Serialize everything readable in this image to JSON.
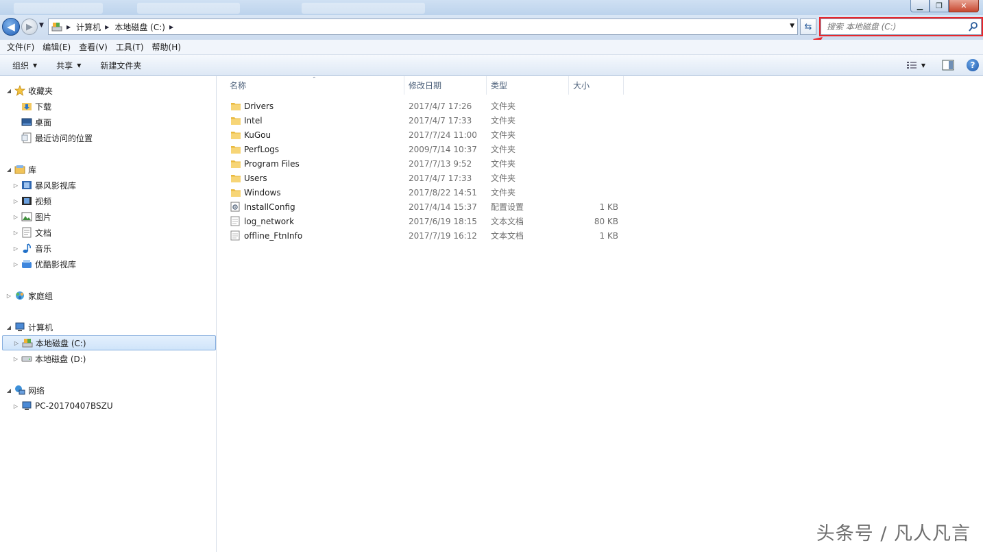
{
  "nav": {
    "breadcrumb": [
      "计算机",
      "本地磁盘 (C:)"
    ]
  },
  "search": {
    "placeholder": "搜索 本地磁盘 (C:)"
  },
  "menu": [
    "文件(F)",
    "编辑(E)",
    "查看(V)",
    "工具(T)",
    "帮助(H)"
  ],
  "toolbar": {
    "organize": "组织",
    "share": "共享",
    "new_folder": "新建文件夹"
  },
  "tree": {
    "favorites": "收藏夹",
    "fav_items": [
      "下载",
      "桌面",
      "最近访问的位置"
    ],
    "libraries": "库",
    "lib_items": [
      "暴风影视库",
      "视频",
      "图片",
      "文档",
      "音乐",
      "优酷影视库"
    ],
    "homegroup": "家庭组",
    "computer": "计算机",
    "drives": [
      "本地磁盘 (C:)",
      "本地磁盘 (D:)"
    ],
    "network": "网络",
    "net_items": [
      "PC-20170407BSZU"
    ]
  },
  "columns": {
    "name": "名称",
    "date": "修改日期",
    "type": "类型",
    "size": "大小"
  },
  "files": [
    {
      "name": "Drivers",
      "date": "2017/4/7 17:26",
      "type": "文件夹",
      "size": "",
      "icon": "folder-icon"
    },
    {
      "name": "Intel",
      "date": "2017/4/7 17:33",
      "type": "文件夹",
      "size": "",
      "icon": "folder-icon"
    },
    {
      "name": "KuGou",
      "date": "2017/7/24 11:00",
      "type": "文件夹",
      "size": "",
      "icon": "folder-icon"
    },
    {
      "name": "PerfLogs",
      "date": "2009/7/14 10:37",
      "type": "文件夹",
      "size": "",
      "icon": "folder-icon"
    },
    {
      "name": "Program Files",
      "date": "2017/7/13 9:52",
      "type": "文件夹",
      "size": "",
      "icon": "folder-icon"
    },
    {
      "name": "Users",
      "date": "2017/4/7 17:33",
      "type": "文件夹",
      "size": "",
      "icon": "folder-icon"
    },
    {
      "name": "Windows",
      "date": "2017/8/22 14:51",
      "type": "文件夹",
      "size": "",
      "icon": "folder-icon"
    },
    {
      "name": "InstallConfig",
      "date": "2017/4/14 15:37",
      "type": "配置设置",
      "size": "1 KB",
      "icon": "config-file-icon"
    },
    {
      "name": "log_network",
      "date": "2017/6/19 18:15",
      "type": "文本文档",
      "size": "80 KB",
      "icon": "text-file-icon"
    },
    {
      "name": "offline_FtnInfo",
      "date": "2017/7/19 16:12",
      "type": "文本文档",
      "size": "1 KB",
      "icon": "text-file-icon"
    }
  ],
  "watermark": "头条号 / 凡人凡言",
  "colors": {
    "highlight_box": "#e8262b",
    "selection": "#cfe4fa"
  }
}
